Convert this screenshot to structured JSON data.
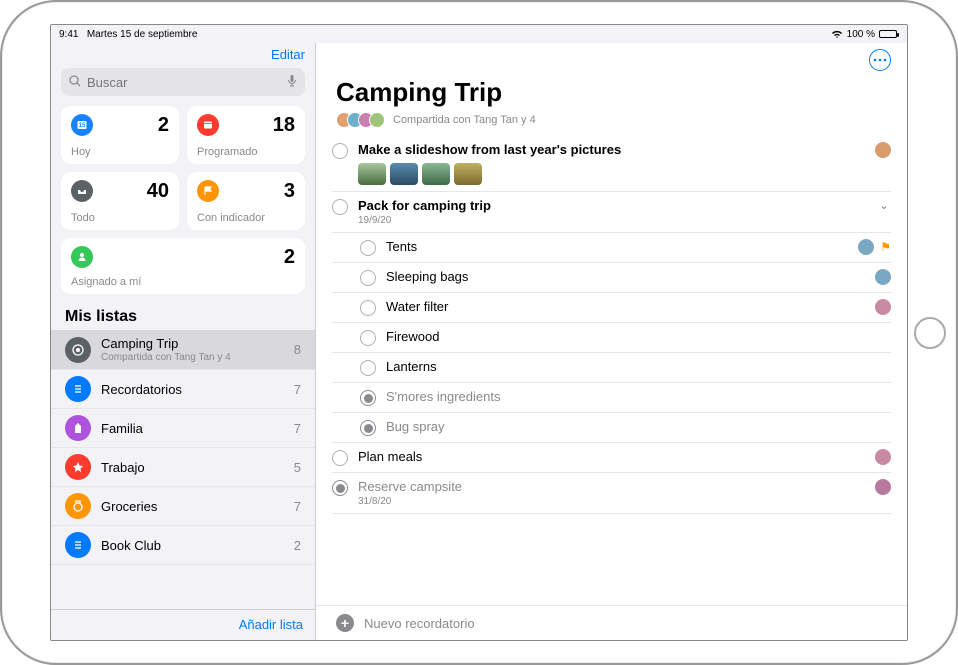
{
  "statusbar": {
    "time": "9:41",
    "date": "Martes 15 de septiembre",
    "battery_text": "100 %"
  },
  "sidebar": {
    "edit_label": "Editar",
    "search_placeholder": "Buscar",
    "smart": {
      "today": {
        "label": "Hoy",
        "count": "2"
      },
      "scheduled": {
        "label": "Programado",
        "count": "18"
      },
      "all": {
        "label": "Todo",
        "count": "40"
      },
      "flagged": {
        "label": "Con indicador",
        "count": "3"
      },
      "assigned": {
        "label": "Asignado a mí",
        "count": "2"
      }
    },
    "section_title": "Mis listas",
    "lists": [
      {
        "name": "Camping Trip",
        "sub": "Compartida con Tang Tan y 4",
        "count": "8",
        "color": "ci-grey",
        "selected": true
      },
      {
        "name": "Recordatorios",
        "sub": "",
        "count": "7",
        "color": "ci-lblue",
        "selected": false
      },
      {
        "name": "Familia",
        "sub": "",
        "count": "7",
        "color": "ci-purple",
        "selected": false
      },
      {
        "name": "Trabajo",
        "sub": "",
        "count": "5",
        "color": "ci-star",
        "selected": false
      },
      {
        "name": "Groceries",
        "sub": "",
        "count": "7",
        "color": "ci-dorange",
        "selected": false
      },
      {
        "name": "Book Club",
        "sub": "",
        "count": "2",
        "color": "ci-lblue",
        "selected": false
      }
    ],
    "add_list_label": "Añadir lista"
  },
  "main": {
    "title": "Camping Trip",
    "shared_label": "Compartida con Tang Tan y 4",
    "new_reminder_label": "Nuevo recordatorio",
    "reminders": [
      {
        "title": "Make a slideshow from last year's pictures",
        "bold": true,
        "done": false,
        "assignee": "asg-a",
        "thumbs": true
      },
      {
        "title": "Pack for camping trip",
        "bold": true,
        "done": false,
        "date": "19/9/20",
        "expandable": true,
        "subtasks": [
          {
            "title": "Tents",
            "done": false,
            "assignee": "asg-b",
            "flagged": true
          },
          {
            "title": "Sleeping bags",
            "done": false,
            "assignee": "asg-b"
          },
          {
            "title": "Water filter",
            "done": false,
            "assignee": "asg-c"
          },
          {
            "title": "Firewood",
            "done": false
          },
          {
            "title": "Lanterns",
            "done": false
          },
          {
            "title": "S'mores ingredients",
            "done": true
          },
          {
            "title": "Bug spray",
            "done": true
          }
        ]
      },
      {
        "title": "Plan meals",
        "done": false,
        "assignee": "asg-c"
      },
      {
        "title": "Reserve campsite",
        "done": true,
        "date": "31/8/20",
        "assignee": "asg-d"
      }
    ]
  }
}
